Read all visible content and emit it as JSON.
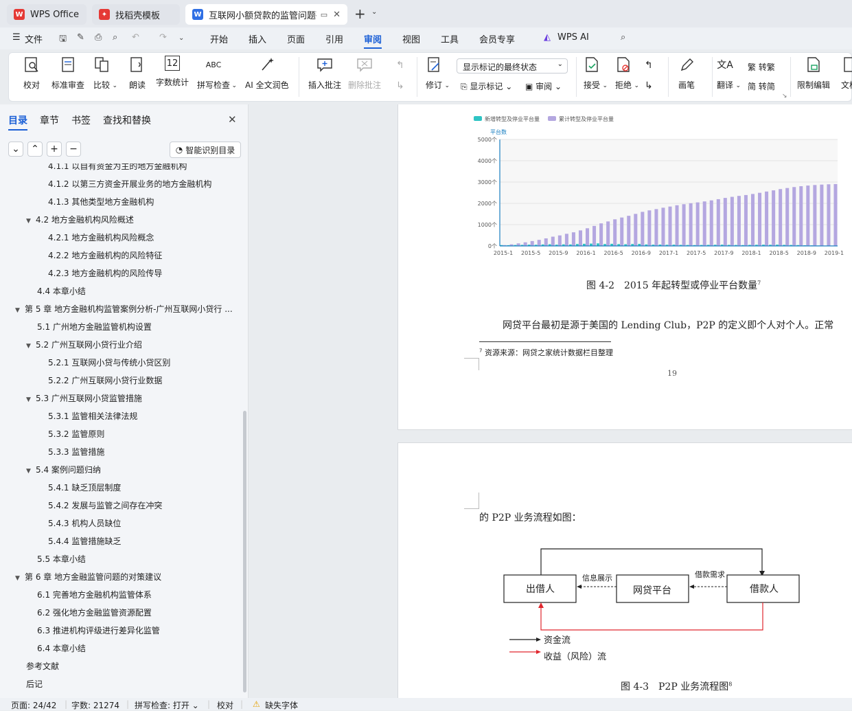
{
  "tabs": {
    "t1": "WPS Office",
    "t2": "找稻壳模板",
    "t3": "互联网小额贷款的监管问题研究",
    "plus": "+"
  },
  "menu": {
    "m0": "文件",
    "m1": "开始",
    "m2": "插入",
    "m3": "页面",
    "m4": "引用",
    "m5": "审阅",
    "m6": "视图",
    "m7": "工具",
    "m8": "会员专享",
    "m9": "WPS AI"
  },
  "ribbon": {
    "b1": "校对",
    "b2": "标准审查",
    "b3": "比较",
    "b4": "朗读",
    "b5": "字数统计",
    "b6": "拼写检查",
    "b7": "AI 全文润色",
    "b8": "插入批注",
    "b9": "删除批注",
    "b10": "修订",
    "b11": "显示标记的最终状态",
    "b12": "显示标记",
    "b13": "审阅",
    "b14": "接受",
    "b15": "拒绝",
    "b16": "画笔",
    "b17": "翻译",
    "b18": "转繁",
    "b19": "转简",
    "b20": "限制编辑",
    "b21": "文档",
    "abc": "ABC",
    "num": "12"
  },
  "nav": {
    "tab1": "目录",
    "tab2": "章节",
    "tab3": "书签",
    "tab4": "查找和替换",
    "smart": "智能识别目录"
  },
  "toc": [
    "4.1.1 以自有资金为主的地方金融机构",
    "4.1.2 以第三方资金开展业务的地方金融机构",
    "4.1.3 其他类型地方金融机构",
    "4.2 地方金融机构风险概述",
    "4.2.1 地方金融机构风险概念",
    "4.2.2 地方金融机构的风险特征",
    "4.2.3 地方金融机构的风险传导",
    "4.4 本章小结",
    "第 5 章 地方金融机构监管案例分析-广州互联网小贷行 ...",
    "5.1 广州地方金融监管机构设置",
    "5.2 广州互联网小贷行业介绍",
    "5.2.1 互联网小贷与传统小贷区别",
    "5.2.2 广州互联网小贷行业数据",
    "5.3 广州互联网小贷监管措施",
    "5.3.1 监管相关法律法规",
    "5.3.2 监管原则",
    "5.3.3 监管措施",
    "5.4 案例问题归纳",
    "5.4.1 缺乏顶层制度",
    "5.4.2 发展与监管之间存在冲突",
    "5.4.3 机构人员缺位",
    "5.4.4 监管措施缺乏",
    "5.5 本章小结",
    "第 6 章 地方金融监管问题的对策建议",
    "6.1 完善地方金融机构监管体系",
    "6.2 强化地方金融监管资源配置",
    "6.3 推进机构评级进行差异化监管",
    "6.4 本章小结",
    "参考文献",
    "后记"
  ],
  "page1": {
    "fig_caption": "图 4-2　2015 年起转型或停业平台数量",
    "fig_sup": "7",
    "body": "网贷平台最初是源于美国的 Lending Club，P2P 的定义即个人对个人。正常",
    "footnote_mark": "7",
    "footnote": "资源来源：网贷之家统计数据栏目整理",
    "page_num": "19"
  },
  "page2": {
    "body": "的 P2P 业务流程如图：",
    "lender": "出借人",
    "platform": "网贷平台",
    "borrower": "借款人",
    "info": "信息展示",
    "demand": "借款需求",
    "fund_flow": "资金流",
    "return_flow": "收益（风险）流",
    "fig_caption": "图 4-3　P2P 业务流程图",
    "fig_sup": "8"
  },
  "status": {
    "page": "页面: 24/42",
    "words": "字数: 21274",
    "spell": "拼写检查: 打开",
    "proof": "校对",
    "font": "缺失字体"
  },
  "chart_data": {
    "type": "bar",
    "title": "",
    "ylabel": "平台数",
    "ylim": [
      0,
      5000
    ],
    "yticks": [
      "5000个",
      "4000个",
      "3000个",
      "2000个",
      "1000个",
      "0个"
    ],
    "x_tick_labels": [
      "2015-1",
      "2015-5",
      "2015-9",
      "2016-1",
      "2016-5",
      "2016-9",
      "2017-1",
      "2017-5",
      "2017-9",
      "2018-1",
      "2018-5",
      "2018-9",
      "2019-1"
    ],
    "series": [
      {
        "name": "新增转型及停业平台量",
        "color": "#2ec4c4",
        "values": [
          40,
          35,
          45,
          50,
          60,
          55,
          70,
          80,
          60,
          75,
          70,
          90,
          100,
          110,
          120,
          90,
          100,
          85,
          80,
          90,
          95,
          70,
          60,
          65,
          55,
          60,
          50,
          45,
          40,
          45,
          50,
          55,
          60,
          50,
          45,
          40,
          50,
          55,
          60,
          55,
          60,
          50,
          45,
          40,
          30,
          25,
          20,
          15,
          10
        ]
      },
      {
        "name": "累计转型及停业平台量",
        "color": "#b4a7e0",
        "values": [
          40,
          75,
          120,
          170,
          230,
          285,
          355,
          435,
          495,
          570,
          640,
          730,
          830,
          940,
          1060,
          1150,
          1250,
          1335,
          1415,
          1505,
          1600,
          1670,
          1730,
          1795,
          1850,
          1910,
          1960,
          2005,
          2045,
          2090,
          2140,
          2195,
          2255,
          2305,
          2350,
          2390,
          2440,
          2495,
          2555,
          2610,
          2670,
          2720,
          2765,
          2805,
          2835,
          2860,
          2880,
          2895,
          2905
        ]
      }
    ]
  }
}
